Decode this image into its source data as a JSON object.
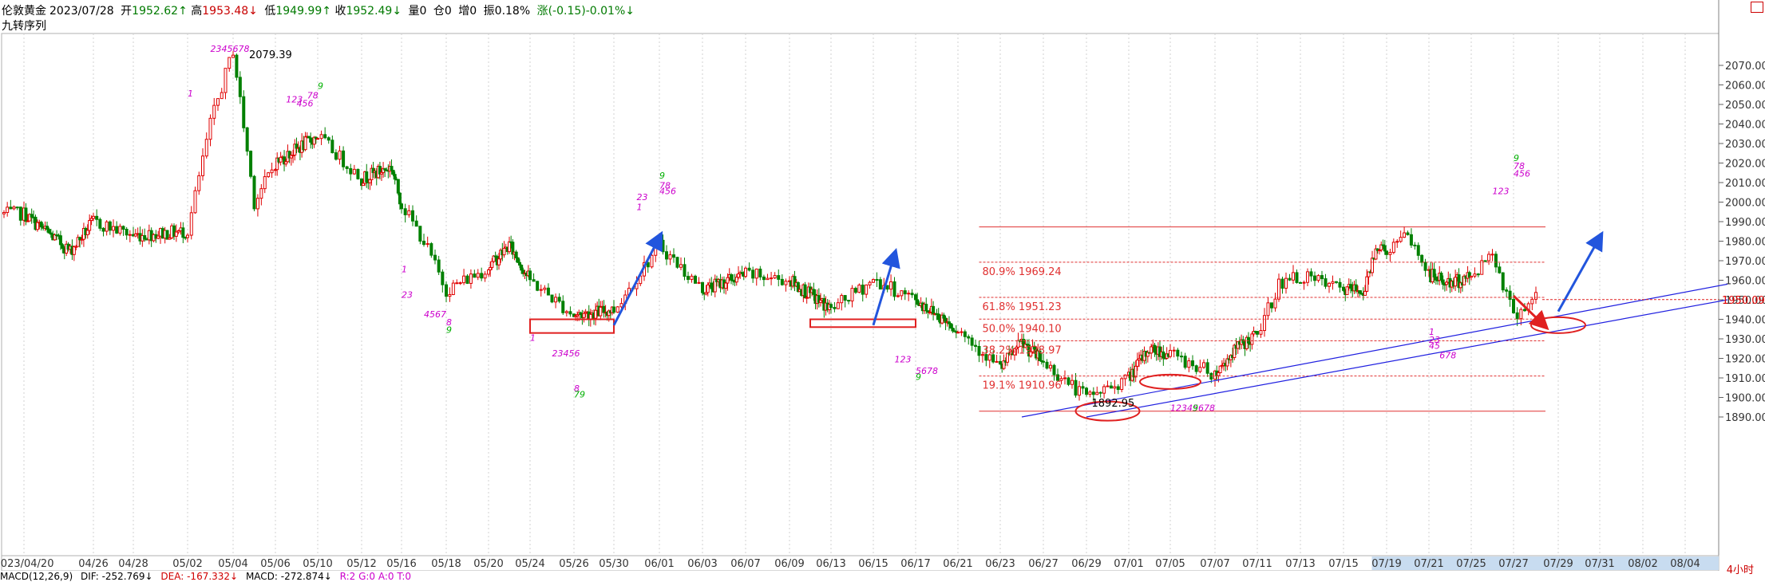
{
  "header": {
    "symbol": "伦敦黄金",
    "date": "2023/07/28",
    "open_label": "开",
    "open": "1952.62",
    "open_arrow": "↑",
    "high_label": "高",
    "high": "1953.48",
    "high_arrow": "↓",
    "low_label": "低",
    "low": "1949.99",
    "low_arrow": "↑",
    "close_label": "收",
    "close": "1952.49",
    "close_arrow": "↓",
    "volume": "量0",
    "oi": "仓0",
    "incr": "增0",
    "amplitude": "振0.18%",
    "change": "涨(-0.15)-0.01%",
    "change_arrow": "↓",
    "indicator_name": "九转序列"
  },
  "bottom_bar": {
    "macd_label": "MACD(12,26,9)",
    "dif": "DIF: -252.769↓",
    "dea": "DEA: -167.332↓",
    "macd": "MACD: -272.874↓",
    "extra": "R:2 G:0 A:0 T:0"
  },
  "timeframe": "4小时",
  "chart_data": {
    "type": "candlestick",
    "price_axis": {
      "min": 1890,
      "max": 2070,
      "step": 10,
      "labels": [
        "2070.00",
        "2060.00",
        "2050.00",
        "2040.00",
        "2030.00",
        "2020.00",
        "2010.00",
        "2000.00",
        "1990.00",
        "1980.00",
        "1970.00",
        "1960.00",
        "1950.00",
        "1940.00",
        "1930.00",
        "1920.00",
        "1910.00",
        "1900.00",
        "1890.00"
      ]
    },
    "date_axis": [
      "2023/04/20",
      "04/26",
      "04/28",
      "05/02",
      "05/04",
      "05/06",
      "05/10",
      "05/12",
      "05/16",
      "05/18",
      "05/20",
      "05/24",
      "05/26",
      "05/30",
      "06/01",
      "06/03",
      "06/07",
      "06/09",
      "06/13",
      "06/15",
      "06/17",
      "06/21",
      "06/23",
      "06/27",
      "06/29",
      "07/01",
      "07/05",
      "07/07",
      "07/11",
      "07/13",
      "07/15",
      "07/19",
      "07/21",
      "07/25",
      "07/27",
      "07/29",
      "07/31",
      "08/02",
      "08/04"
    ],
    "last_price": "1950.09",
    "high_annotation": "2079.39",
    "low_annotation": "1892.95",
    "fib_levels": [
      {
        "label": "80.9% 1969.24",
        "price": 1969.24
      },
      {
        "label": "61.8% 1951.23",
        "price": 1951.23
      },
      {
        "label": "50.0% 1940.10",
        "price": 1940.1
      },
      {
        "label": "38.2% 1928.97",
        "price": 1928.97
      },
      {
        "label": "19.1% 1910.96",
        "price": 1910.96
      }
    ],
    "fib_top": 1987.3,
    "fib_bottom": 1892.95,
    "key_prices": [
      {
        "date": "04/20",
        "price": 1994
      },
      {
        "date": "04/24",
        "price": 1975
      },
      {
        "date": "04/26",
        "price": 1990
      },
      {
        "date": "04/28",
        "price": 1983
      },
      {
        "date": "05/02",
        "price": 1985
      },
      {
        "date": "05/03",
        "price": 2040
      },
      {
        "date": "05/04",
        "price": 2078
      },
      {
        "date": "05/05",
        "price": 2000
      },
      {
        "date": "05/06",
        "price": 2020
      },
      {
        "date": "05/10",
        "price": 2034
      },
      {
        "date": "05/12",
        "price": 2012
      },
      {
        "date": "05/15",
        "price": 2018
      },
      {
        "date": "05/17",
        "price": 1980
      },
      {
        "date": "05/18",
        "price": 1955
      },
      {
        "date": "05/22",
        "price": 1978
      },
      {
        "date": "05/24",
        "price": 1960
      },
      {
        "date": "05/26",
        "price": 1942
      },
      {
        "date": "05/30",
        "price": 1945
      },
      {
        "date": "06/01",
        "price": 1978
      },
      {
        "date": "06/03",
        "price": 1955
      },
      {
        "date": "06/07",
        "price": 1963
      },
      {
        "date": "06/09",
        "price": 1960
      },
      {
        "date": "06/13",
        "price": 1945
      },
      {
        "date": "06/15",
        "price": 1960
      },
      {
        "date": "06/17",
        "price": 1950
      },
      {
        "date": "06/21",
        "price": 1935
      },
      {
        "date": "06/23",
        "price": 1915
      },
      {
        "date": "06/25",
        "price": 1928
      },
      {
        "date": "06/27",
        "price": 1918
      },
      {
        "date": "06/29",
        "price": 1900
      },
      {
        "date": "07/01",
        "price": 1910
      },
      {
        "date": "07/03",
        "price": 1925
      },
      {
        "date": "07/05",
        "price": 1922
      },
      {
        "date": "07/07",
        "price": 1912
      },
      {
        "date": "07/09",
        "price": 1925
      },
      {
        "date": "07/11",
        "price": 1932
      },
      {
        "date": "07/12",
        "price": 1958
      },
      {
        "date": "07/13",
        "price": 1962
      },
      {
        "date": "07/15",
        "price": 1955
      },
      {
        "date": "07/17",
        "price": 1955
      },
      {
        "date": "07/18",
        "price": 1978
      },
      {
        "date": "07/19",
        "price": 1975
      },
      {
        "date": "07/20",
        "price": 1983
      },
      {
        "date": "07/21",
        "price": 1963
      },
      {
        "date": "07/23",
        "price": 1958
      },
      {
        "date": "07/25",
        "price": 1962
      },
      {
        "date": "07/26",
        "price": 1975
      },
      {
        "date": "07/27",
        "price": 1942
      },
      {
        "date": "07/28",
        "price": 1952
      }
    ],
    "td_sequence_labels": [
      {
        "text": "1",
        "date": "05/02",
        "price": 2054,
        "color": "#cc00cc"
      },
      {
        "text": "2345678",
        "date": "05/03",
        "price": 2077,
        "color": "#cc00cc"
      },
      {
        "text": "123",
        "date": "05/07",
        "price": 2051,
        "color": "#cc00cc"
      },
      {
        "text": "456",
        "date": "05/08",
        "price": 2049,
        "color": "#cc00cc"
      },
      {
        "text": "78",
        "date": "05/09",
        "price": 2053,
        "color": "#cc00cc"
      },
      {
        "text": "9",
        "date": "05/10",
        "price": 2058,
        "color": "#00b000"
      },
      {
        "text": "1",
        "date": "05/16",
        "price": 1964,
        "color": "#cc00cc"
      },
      {
        "text": "23",
        "date": "05/16",
        "price": 1951,
        "color": "#cc00cc"
      },
      {
        "text": "4567",
        "date": "05/17",
        "price": 1941,
        "color": "#cc00cc"
      },
      {
        "text": "8",
        "date": "05/18",
        "price": 1937,
        "color": "#cc00cc"
      },
      {
        "text": "9",
        "date": "05/18",
        "price": 1933,
        "color": "#00b000"
      },
      {
        "text": "1",
        "date": "05/24",
        "price": 1929,
        "color": "#cc00cc"
      },
      {
        "text": "23456",
        "date": "05/25",
        "price": 1921,
        "color": "#cc00cc"
      },
      {
        "text": "8",
        "date": "05/26",
        "price": 1903,
        "color": "#cc00cc"
      },
      {
        "text": "79",
        "date": "05/26",
        "price": 1900,
        "color": "#00b000"
      },
      {
        "text": "1",
        "date": "05/31",
        "price": 1996,
        "color": "#cc00cc"
      },
      {
        "text": "23",
        "date": "05/31",
        "price": 2001,
        "color": "#cc00cc"
      },
      {
        "text": "456",
        "date": "06/01",
        "price": 2004,
        "color": "#cc00cc"
      },
      {
        "text": "78",
        "date": "06/01",
        "price": 2007,
        "color": "#cc00cc"
      },
      {
        "text": "9",
        "date": "06/01",
        "price": 2012,
        "color": "#00b000"
      },
      {
        "text": "123",
        "date": "06/16",
        "price": 1918,
        "color": "#cc00cc"
      },
      {
        "text": "5678",
        "date": "06/17",
        "price": 1912,
        "color": "#cc00cc"
      },
      {
        "text": "9",
        "date": "06/17",
        "price": 1909,
        "color": "#00b000"
      },
      {
        "text": "12345678",
        "date": "07/05",
        "price": 1893,
        "color": "#cc00cc"
      },
      {
        "text": "9",
        "date": "07/06",
        "price": 1893,
        "color": "#00b000"
      },
      {
        "text": "1",
        "date": "07/21",
        "price": 1932,
        "color": "#cc00cc"
      },
      {
        "text": "23",
        "date": "07/21",
        "price": 1928,
        "color": "#cc00cc"
      },
      {
        "text": "45",
        "date": "07/21",
        "price": 1925,
        "color": "#cc00cc"
      },
      {
        "text": "678",
        "date": "07/22",
        "price": 1920,
        "color": "#cc00cc"
      },
      {
        "text": "123",
        "date": "07/26",
        "price": 2004,
        "color": "#cc00cc"
      },
      {
        "text": "456",
        "date": "07/27",
        "price": 2013,
        "color": "#cc00cc"
      },
      {
        "text": "78",
        "date": "07/27",
        "price": 2017,
        "color": "#cc00cc"
      },
      {
        "text": "9",
        "date": "07/27",
        "price": 2021,
        "color": "#00b000"
      }
    ],
    "annotations": {
      "boxes": [
        {
          "from": "05/24",
          "to": "05/30",
          "price_low": 1933,
          "price_high": 1940
        },
        {
          "from": "06/11",
          "to": "06/17",
          "price_low": 1936,
          "price_high": 1940
        }
      ],
      "ellipses": [
        {
          "center_date": "06/30",
          "price": 1893
        },
        {
          "center_date": "07/05",
          "price": 1908
        },
        {
          "center_date": "07/29",
          "price": 1937
        }
      ],
      "blue_arrows": [
        {
          "from_date": "05/30",
          "from_price": 1937,
          "to_date": "06/01",
          "to_price": 1982
        },
        {
          "from_date": "06/15",
          "from_price": 1937,
          "to_date": "06/16",
          "to_price": 1973
        },
        {
          "from_date": "07/29",
          "from_price": 1944,
          "to_date": "07/31",
          "to_price": 1982
        }
      ],
      "red_arrow": {
        "from_date": "07/27",
        "from_price": 1952,
        "to_date": "07/28",
        "to_price": 1937
      },
      "trendlines": [
        {
          "from_date": "06/25",
          "from_price": 1890,
          "to_date": "08/06",
          "to_price": 1958
        },
        {
          "from_date": "06/29",
          "from_price": 1890,
          "to_date": "08/06",
          "to_price": 1950
        }
      ]
    },
    "colors": {
      "up": "#e00000",
      "down": "#008000",
      "fib": "#e03030",
      "trendline": "#2020e0",
      "arrow": "#2255dd",
      "td_setup": "#cc00cc",
      "td_nine": "#00b000",
      "highlight_axis": "#c8dcf0"
    },
    "highlighted_dates": [
      "07/19",
      "07/21",
      "07/25",
      "07/27",
      "07/29",
      "07/31",
      "08/02",
      "08/04"
    ]
  }
}
